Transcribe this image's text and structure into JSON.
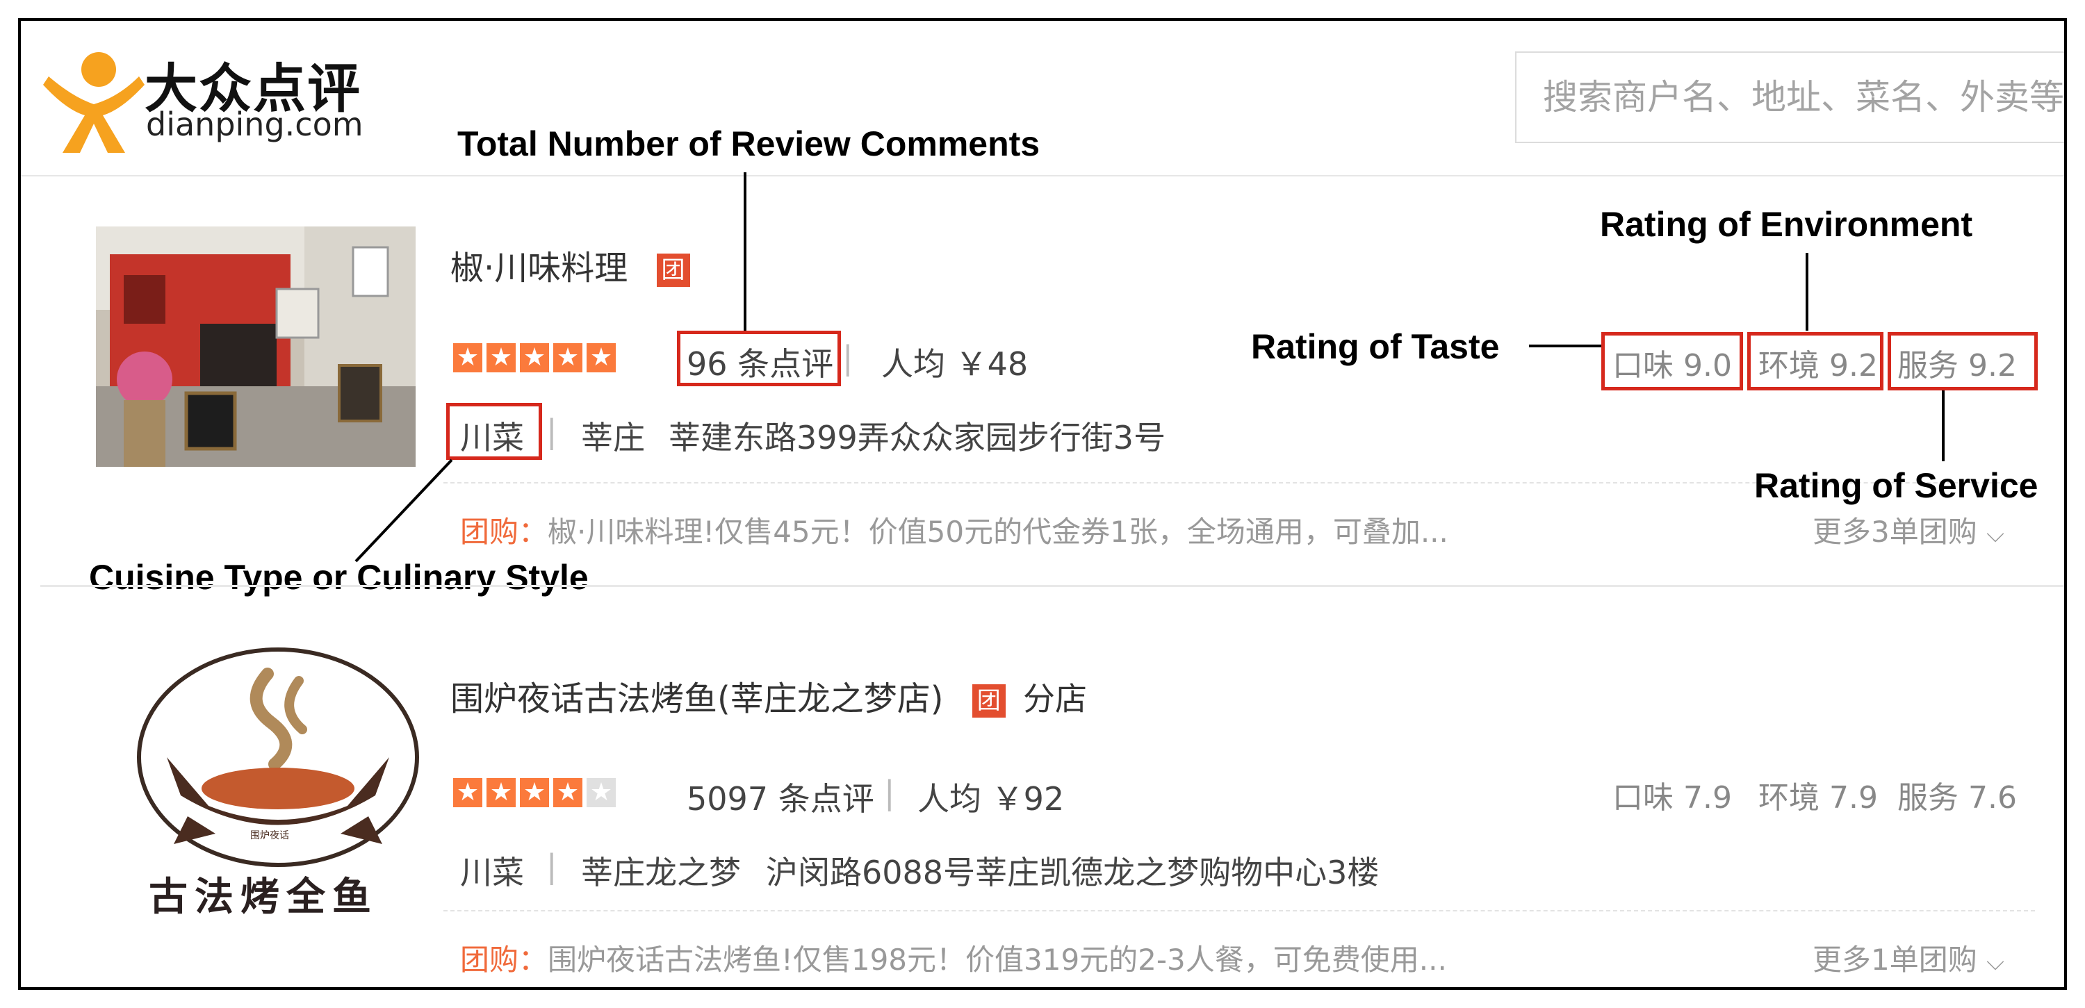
{
  "header": {
    "logo_cn": "大众点评",
    "logo_en": "dianping.com",
    "search_placeholder": "搜索商户名、地址、菜名、外卖等"
  },
  "annotations": {
    "review_count": "Total Number of Review Comments",
    "environment": "Rating of Environment",
    "taste": "Rating of Taste",
    "service": "Rating of Service",
    "cuisine": "Cuisine Type or Culinary Style"
  },
  "listings": [
    {
      "name": "椒·川味料理",
      "badge": "团",
      "branch": "",
      "stars": 5,
      "reviews": "96 条点评",
      "price": "人均 ￥48",
      "cuisine": "川菜",
      "area": "莘庄",
      "address": "莘建东路399弄众众家园步行街3号",
      "promo_label": "团购：",
      "promo_text": "椒·川味料理!仅售45元！价值50元的代金券1张，全场通用，可叠加...",
      "more_deals": "更多3单团购",
      "taste": "口味 9.0",
      "environment": "环境 9.2",
      "service": "服务 9.2"
    },
    {
      "name": "围炉夜话古法烤鱼(莘庄龙之梦店)",
      "badge": "团",
      "branch": "分店",
      "stars": 4,
      "reviews": "5097 条点评",
      "price": "人均 ￥92",
      "cuisine": "川菜",
      "area": "莘庄龙之梦",
      "address": "沪闵路6088号莘庄凯德龙之梦购物中心3楼",
      "promo_label": "团购：",
      "promo_text": "围炉夜话古法烤鱼!仅售198元！价值319元的2-3人餐，可免费使用...",
      "more_deals": "更多1单团购",
      "taste": "口味 7.9",
      "environment": "环境 7.9",
      "service": "服务 7.6",
      "logo_text_small": "围炉夜话",
      "logo_text_large": "古法烤全鱼"
    }
  ],
  "colors": {
    "accent": "#f06a3b",
    "star": "#fb7a3c",
    "annotation_box": "#d6281c"
  }
}
